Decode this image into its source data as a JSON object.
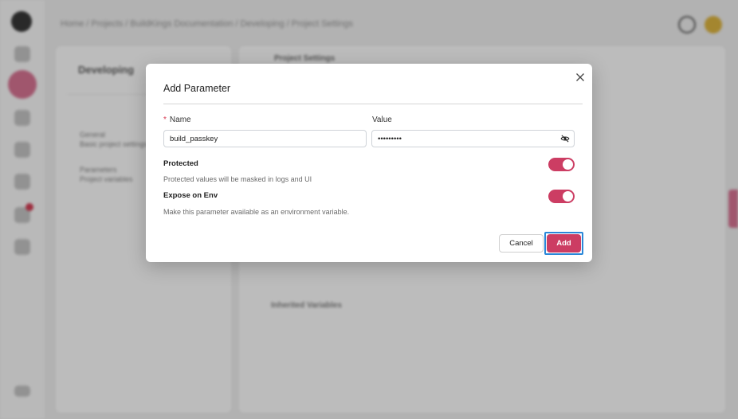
{
  "background": {
    "breadcrumb": "Home / Projects / BuildKings Documentation / Developing / Project Settings",
    "left_panel": {
      "title": "Developing",
      "items": [
        {
          "title": "General",
          "subtitle": "Basic project settings"
        },
        {
          "title": "Parameters",
          "subtitle": "Project variables"
        }
      ]
    },
    "right_panel": {
      "title": "Project Settings",
      "inherited_label": "Inherited Variables"
    }
  },
  "modal": {
    "title": "Add Parameter",
    "name_field": {
      "label": "Name",
      "value": "build_passkey",
      "required_mark": "*"
    },
    "value_field": {
      "label": "Value",
      "value": "secretkey"
    },
    "protected": {
      "label": "Protected",
      "description": "Protected values will be masked in logs and UI",
      "on": true
    },
    "expose_env": {
      "label": "Expose on Env",
      "description": "Make this parameter available as an environment variable.",
      "on": true
    },
    "cancel_label": "Cancel",
    "add_label": "Add"
  },
  "colors": {
    "accent": "#cc3d63",
    "focus_ring": "#2a87d8"
  },
  "icons": [
    "close-icon",
    "eye-slash-icon"
  ]
}
